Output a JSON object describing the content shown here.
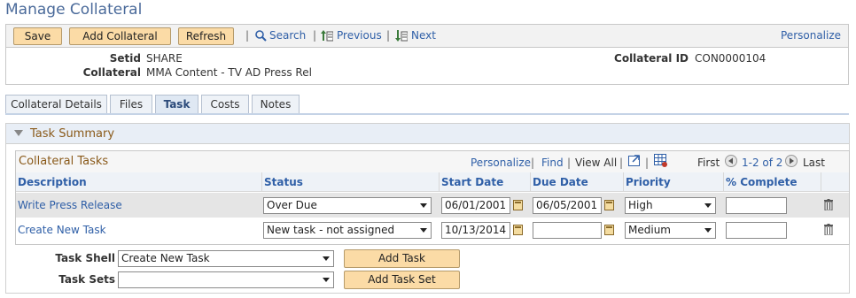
{
  "page": {
    "title": "Manage Collateral"
  },
  "toolbar": {
    "save": "Save",
    "add_collateral": "Add Collateral",
    "refresh": "Refresh",
    "search": "Search",
    "previous": "Previous",
    "next": "Next",
    "personalize": "Personalize"
  },
  "header": {
    "setid_label": "Setid",
    "setid_value": "SHARE",
    "collateral_label": "Collateral",
    "collateral_value": "MMA Content - TV AD Press Rel",
    "collateral_id_label": "Collateral ID",
    "collateral_id_value": "CON0000104"
  },
  "tabs": [
    {
      "label": "Collateral Details"
    },
    {
      "label": "Files"
    },
    {
      "label": "Task"
    },
    {
      "label": "Costs"
    },
    {
      "label": "Notes"
    }
  ],
  "section": {
    "title": "Task Summary"
  },
  "grid": {
    "title": "Collateral Tasks",
    "personalize": "Personalize",
    "find": "Find",
    "view_all": "View All",
    "first": "First",
    "range": "1-2 of 2",
    "last": "Last",
    "columns": [
      "Description",
      "Status",
      "Start Date",
      "Due Date",
      "Priority",
      "% Complete"
    ],
    "rows": [
      {
        "description": "Write Press Release",
        "status": "Over Due",
        "start_date": "06/01/2001",
        "due_date": "06/05/2001",
        "priority": "High",
        "complete": ""
      },
      {
        "description": "Create New Task",
        "status": "New task - not assigned",
        "start_date": "10/13/2014",
        "due_date": "",
        "priority": "Medium",
        "complete": ""
      }
    ]
  },
  "footer": {
    "task_shell_label": "Task Shell",
    "task_shell_value": "Create New Task",
    "task_sets_label": "Task Sets",
    "task_sets_value": "",
    "add_task": "Add Task",
    "add_task_set": "Add Task Set"
  },
  "colors": {
    "link": "#2f5fa7",
    "button": "#fbdba6",
    "title": "#4a6a9a"
  }
}
